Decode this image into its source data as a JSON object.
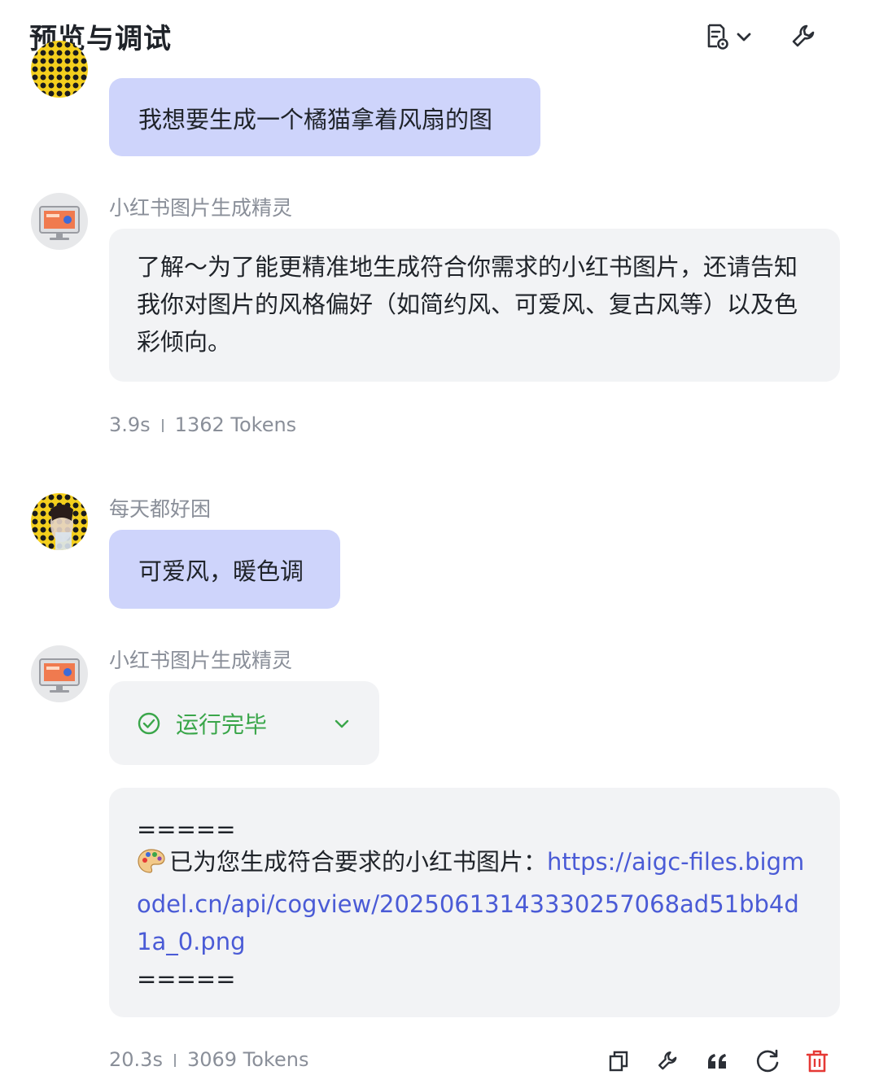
{
  "header": {
    "title": "预览与调试",
    "icons": [
      "document-settings-icon",
      "chevron-down-icon",
      "wrench-icon"
    ]
  },
  "messages": {
    "m1": {
      "text": "我想要生成一个橘猫拿着风扇的图"
    },
    "m2": {
      "sender": "小红书图片生成精灵",
      "text": "了解～为了能更精准地生成符合你需求的小红书图片，还请告知我你对图片的风格偏好（如简约风、可爱风、复古风等）以及色彩倾向。",
      "time": "3.9s",
      "tokens": "1362 Tokens"
    },
    "m3": {
      "sender": "每天都好困",
      "text": "可爱风，暖色调"
    },
    "m4": {
      "sender": "小红书图片生成精灵",
      "status": "运行完毕",
      "divider_top": "=====",
      "prefix": "已为您生成符合要求的小红书图片：",
      "link": "https://aigc-files.bigmodel.cn/api/cogview/20250613143330257068ad51bb4d1a_0.png",
      "divider_bottom": "=====",
      "time": "20.3s",
      "tokens": "3069 Tokens"
    }
  },
  "actions": [
    "copy-icon",
    "wrench-icon",
    "quote-icon",
    "regenerate-icon",
    "delete-icon"
  ],
  "colors": {
    "user_bubble": "#ced4fb",
    "bot_bubble": "#f2f3f5",
    "link": "#4a5bd6",
    "success": "#3aa64a",
    "danger": "#e53935"
  }
}
